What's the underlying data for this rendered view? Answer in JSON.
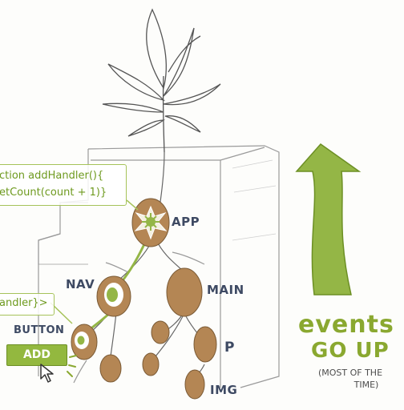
{
  "code_box_app": {
    "line1": "ction addHandler(){",
    "line2": "etCount(count + 1)}"
  },
  "code_box_button": {
    "line1": "andler}>"
  },
  "labels": {
    "app": "APP",
    "nav": "NAV",
    "main": "MAIN",
    "button": "BUTTON",
    "p": "P",
    "img": "IMG",
    "add": "ADD"
  },
  "headline": {
    "line1": "events",
    "line2": "go up"
  },
  "note": {
    "line1": "(MOST OF THE",
    "line2": "TIME)"
  },
  "colors": {
    "accent_green": "#8aa830",
    "arrow_green": "#94b646",
    "potato": "#b48654",
    "label_ink": "#3e4a63"
  },
  "icons": [
    "plant-icon",
    "arrow-up-icon",
    "cursor-icon"
  ]
}
